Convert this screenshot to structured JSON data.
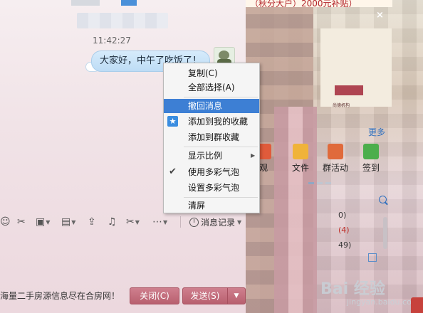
{
  "chat": {
    "timestamp": "11:42:27",
    "message": "大家好，中午了吃饭了！"
  },
  "context_menu": {
    "items": [
      {
        "label": "复制(C)"
      },
      {
        "label": "全部选择(A)"
      },
      {
        "label": "撤回消息",
        "highlighted": true
      },
      {
        "label": "添加到我的收藏",
        "icon": "star-icon"
      },
      {
        "label": "添加到群收藏"
      },
      {
        "label": "显示比例",
        "submenu": true
      },
      {
        "label": "使用多彩气泡",
        "checked": true
      },
      {
        "label": "设置多彩气泡"
      },
      {
        "label": "清屏"
      }
    ]
  },
  "toolbar": {
    "icons": [
      "emoji-icon",
      "scissors-pin-icon",
      "gift-icon",
      "image-icon",
      "upload-icon",
      "music-icon",
      "screenshot-icon",
      "more-icon"
    ],
    "history_label": "消息记录"
  },
  "footer": {
    "ad_text": "海量二手房源信息尽在合房网！",
    "close_label": "关闭(C)",
    "send_label": "发送(S)",
    "send_dropdown": "▼"
  },
  "right_panel": {
    "promo_text": "（秋分大户）2000元补贴）",
    "close_symbol": "×",
    "logo_text": "尚德机构",
    "more_label": "更多",
    "apps": [
      {
        "label": "观",
        "color": "#e05b3b",
        "icon": "camera-icon"
      },
      {
        "label": "文件",
        "color": "#f0b33a",
        "icon": "folder-icon"
      },
      {
        "label": "群活动",
        "color": "#e06a3b",
        "icon": "flag-icon"
      },
      {
        "label": "签到",
        "color": "#4cae4c",
        "icon": "checkin-icon"
      }
    ],
    "side_label": "应",
    "member_header": "成",
    "member_counts": [
      "0)",
      "(4)",
      "49)"
    ]
  },
  "watermark": {
    "text": "Bai 经验",
    "sub": "jingyan.baidu.com"
  },
  "colors": {
    "accent": "#3d7fd4",
    "button": "#b8606f"
  }
}
